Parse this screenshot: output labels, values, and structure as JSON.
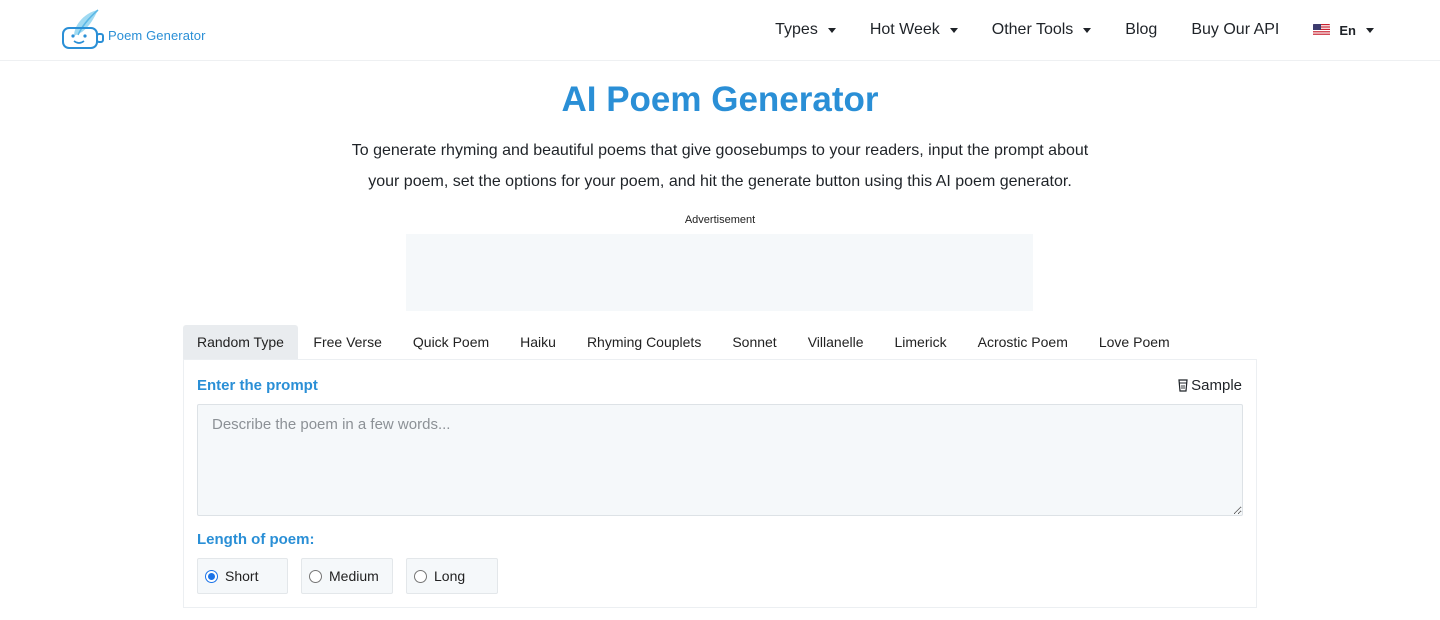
{
  "header": {
    "logo_text": "Poem Generator",
    "nav": [
      {
        "label": "Types",
        "dropdown": true
      },
      {
        "label": "Hot Week",
        "dropdown": true
      },
      {
        "label": "Other Tools",
        "dropdown": true
      },
      {
        "label": "Blog",
        "dropdown": false
      },
      {
        "label": "Buy Our API",
        "dropdown": false
      }
    ],
    "language": {
      "label": "En",
      "flag": "us-flag-icon"
    }
  },
  "hero": {
    "title": "AI Poem Generator",
    "intro": "To generate rhyming and beautiful poems that give goosebumps to your readers, input the prompt about your poem, set the options for your poem, and hit the generate button using this AI poem generator.",
    "ad_label": "Advertisement"
  },
  "tabs": [
    {
      "label": "Random Type",
      "active": true
    },
    {
      "label": "Free Verse",
      "active": false
    },
    {
      "label": "Quick Poem",
      "active": false
    },
    {
      "label": "Haiku",
      "active": false
    },
    {
      "label": "Rhyming Couplets",
      "active": false
    },
    {
      "label": "Sonnet",
      "active": false
    },
    {
      "label": "Villanelle",
      "active": false
    },
    {
      "label": "Limerick",
      "active": false
    },
    {
      "label": "Acrostic Poem",
      "active": false
    },
    {
      "label": "Love Poem",
      "active": false
    }
  ],
  "form": {
    "prompt_label": "Enter the prompt",
    "sample_label": "Sample",
    "prompt_placeholder": "Describe the poem in a few words...",
    "prompt_value": "",
    "length_label": "Length of poem:",
    "length_options": [
      {
        "label": "Short",
        "checked": true
      },
      {
        "label": "Medium",
        "checked": false
      },
      {
        "label": "Long",
        "checked": false
      }
    ]
  },
  "colors": {
    "accent": "#2a8fd6",
    "radio_selected": "#1a73e8",
    "input_bg": "#f5f8fa"
  }
}
